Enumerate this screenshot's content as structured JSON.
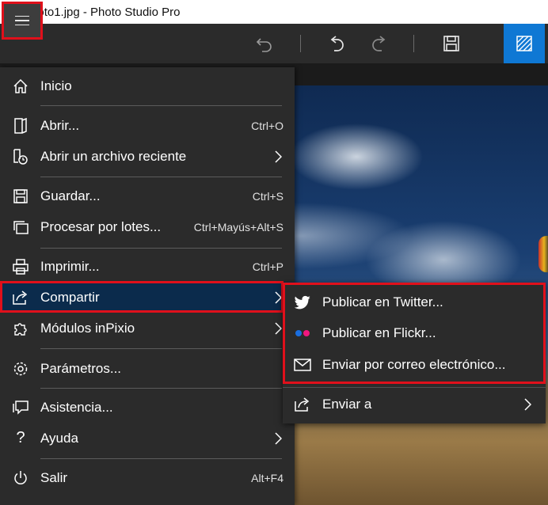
{
  "window": {
    "title": "Photo1.jpg - Photo Studio Pro",
    "icon": "app-logo-icon"
  },
  "toolbar": {
    "menu_icon": "hamburger-icon",
    "icons": [
      "undo-all-icon",
      "undo-icon",
      "redo-icon",
      "save-icon",
      "view-mode-icon"
    ],
    "accent": "#0F78D4"
  },
  "menu": {
    "items": [
      {
        "label": "Inicio",
        "shortcut": "",
        "icon": "home-icon"
      },
      {
        "label": "Abrir...",
        "shortcut": "Ctrl+O",
        "icon": "open-icon"
      },
      {
        "label": "Abrir un archivo reciente",
        "shortcut": "",
        "icon": "recent-file-icon"
      },
      {
        "label": "Guardar...",
        "shortcut": "Ctrl+S",
        "icon": "save-icon"
      },
      {
        "label": "Procesar por lotes...",
        "shortcut": "Ctrl+Mayús+Alt+S",
        "icon": "batch-icon"
      },
      {
        "label": "Imprimir...",
        "shortcut": "Ctrl+P",
        "icon": "print-icon"
      },
      {
        "label": "Compartir",
        "shortcut": "",
        "icon": "share-icon"
      },
      {
        "label": "Módulos inPixio",
        "shortcut": "",
        "icon": "puzzle-icon"
      },
      {
        "label": "Parámetros...",
        "shortcut": "",
        "icon": "settings-icon"
      },
      {
        "label": "Asistencia...",
        "shortcut": "",
        "icon": "chat-icon"
      },
      {
        "label": "Ayuda",
        "shortcut": "",
        "icon": "help-icon"
      },
      {
        "label": "Salir",
        "shortcut": "Alt+F4",
        "icon": "power-icon"
      }
    ],
    "highlight_color": "#0B2B4C"
  },
  "submenu": {
    "items": [
      {
        "label": "Publicar en Twitter...",
        "icon": "twitter-icon"
      },
      {
        "label": "Publicar en Flickr...",
        "icon": "flickr-icon"
      },
      {
        "label": "Enviar por correo electrónico...",
        "icon": "mail-icon"
      },
      {
        "label": "Enviar a",
        "icon": "send-to-icon"
      }
    ]
  },
  "colors": {
    "annotation_red": "#E0101B",
    "menu_bg": "#2B2B2B"
  }
}
